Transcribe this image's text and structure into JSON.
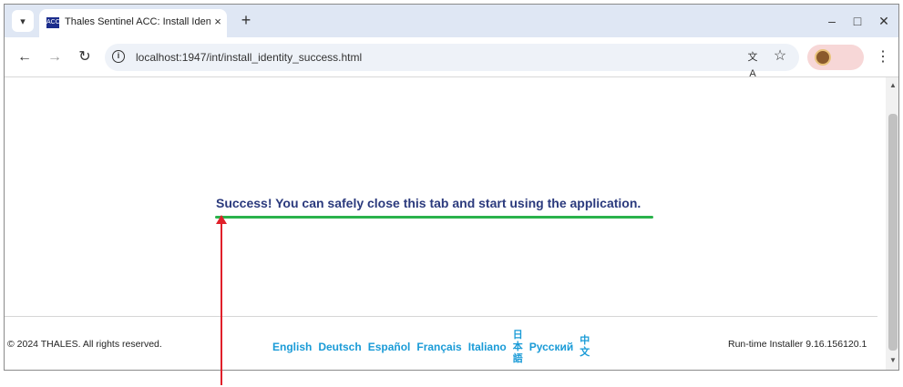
{
  "browser": {
    "tab_title": "Thales Sentinel ACC: Install Identity",
    "favicon_text": "ACC",
    "tab_close": "×",
    "new_tab": "+",
    "url": "localhost:1947/int/install_identity_success.html",
    "window": {
      "minimize": "–",
      "maximize": "□",
      "close": "✕"
    }
  },
  "page": {
    "success_message": "Success! You can safely close this tab and start using the application.",
    "copyright": "© 2024 THALES. All rights reserved.",
    "languages": [
      "English",
      "Deutsch",
      "Español",
      "Français",
      "Italiano",
      "日本語",
      "Русский",
      "中文"
    ],
    "runtime": "Run-time Installer 9.16.156120.1"
  },
  "colors": {
    "accent_green": "#2ab24b",
    "link_blue": "#1a9bd7",
    "heading_navy": "#2b3a7d",
    "annotation_red": "#e0202a"
  }
}
